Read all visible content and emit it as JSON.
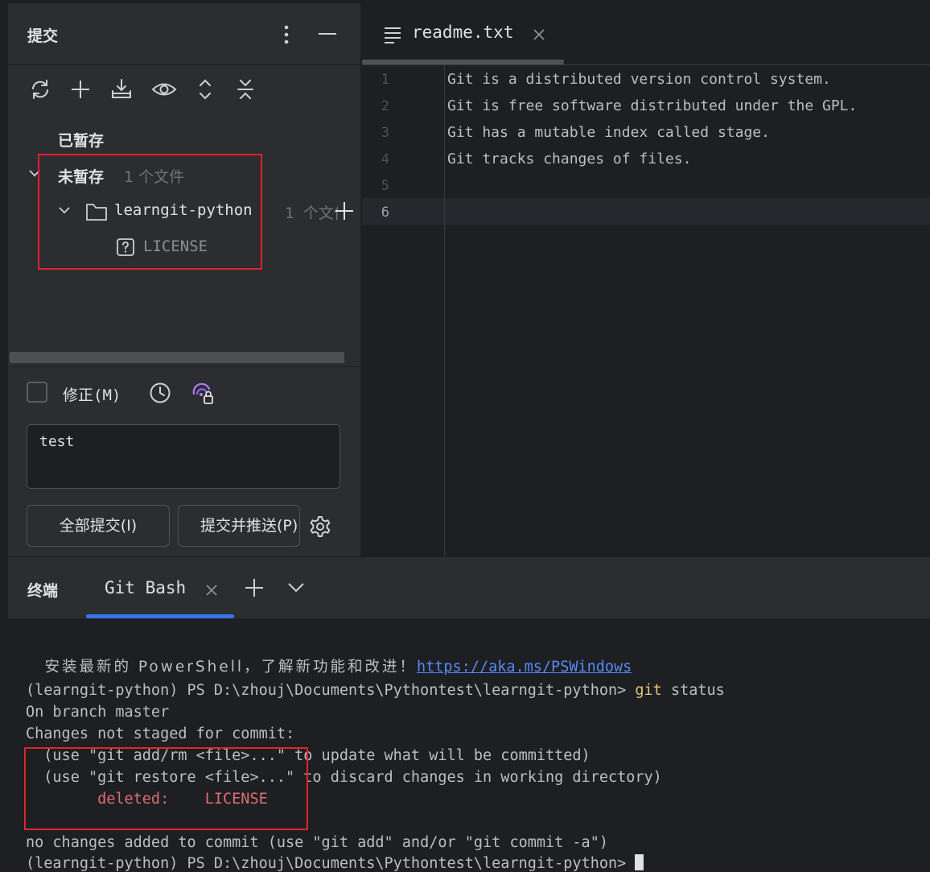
{
  "commit_panel": {
    "title": "提交",
    "staged_label": "已暂存",
    "unstaged_label": "未暂存",
    "unstaged_count": "1 个文件",
    "folder_name": "learngit-python",
    "folder_count": "1 个文件",
    "file_name": "LICENSE",
    "amend_label": "修正(M)",
    "commit_message": "test",
    "commit_all_label": "全部提交(I)",
    "commit_push_label": "提交并推送(P)"
  },
  "editor": {
    "tab_label": "readme.txt",
    "lines": [
      {
        "num": "1",
        "text": "Git is a distributed version control system."
      },
      {
        "num": "2",
        "text": "Git is free software distributed under the GPL."
      },
      {
        "num": "3",
        "text": "Git has a mutable index called stage."
      },
      {
        "num": "4",
        "text": "Git tracks changes of files."
      },
      {
        "num": "5",
        "text": ""
      },
      {
        "num": "6",
        "text": ""
      }
    ]
  },
  "terminal": {
    "title": "终端",
    "tab_label": "Git Bash",
    "install_text": "安装最新的 PowerShell，了解新功能和改进！",
    "install_link": "https://aka.ms/PSWindows",
    "prompt": "(learngit-python) PS D:\\zhouj\\Documents\\Pythontest\\learngit-python> ",
    "command_name": "git",
    "command_args": " status",
    "output": [
      "On branch master",
      "Changes not staged for commit:",
      "  (use \"git add/rm <file>...\" to update what will be committed)",
      "  (use \"git restore <file>...\" to discard changes in working directory)"
    ],
    "deleted_label": "        deleted:    LICENSE",
    "no_changes": "no changes added to commit (use \"git add\" and/or \"git commit -a\")",
    "last_prompt": "(learngit-python) PS D:\\zhouj\\Documents\\Pythontest\\learngit-python> "
  },
  "colors": {
    "accent": "#3574f0",
    "highlight_box": "#e0232e",
    "git_command": "#e5c07b",
    "deleted": "#e06c75"
  }
}
